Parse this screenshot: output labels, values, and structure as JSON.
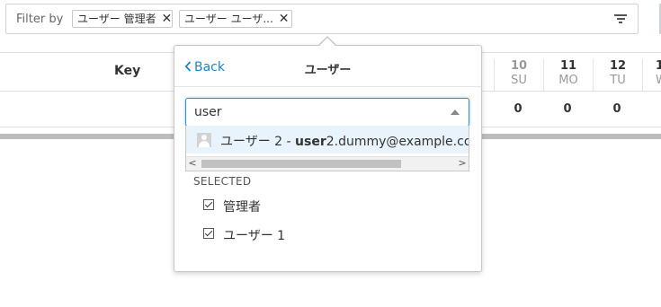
{
  "filter": {
    "label": "Filter by",
    "chips": [
      {
        "text": "ユーザー 管理者",
        "close": "✕"
      },
      {
        "text": "ユーザー ユーザ...",
        "close": "✕"
      }
    ]
  },
  "table": {
    "key_header": "Key",
    "days": [
      {
        "num": "10",
        "name": "SU",
        "muted": true
      },
      {
        "num": "11",
        "name": "MO"
      },
      {
        "num": "12",
        "name": "TU"
      },
      {
        "num": "1",
        "name": "W"
      }
    ],
    "counts": [
      "0",
      "0",
      "0"
    ]
  },
  "popover": {
    "back_label": "Back",
    "title": "ユーザー",
    "search_value": "user",
    "result": {
      "name": "ユーザー 2",
      "separator": " - ",
      "match": "user",
      "rest": "2.dummy@example.co"
    },
    "scroll_left": "<",
    "scroll_right": ">",
    "selected_label": "SELECTED",
    "selected_items": [
      "管理者",
      "ユーザー 1"
    ]
  },
  "icons": {
    "filter": "filter-lines-icon",
    "back": "chevron-left-icon",
    "dropdown": "caret-up-icon",
    "avatar": "user-avatar-icon",
    "check": "checkbox-checked-icon"
  },
  "colors": {
    "accent": "#1a86c8",
    "focus_border": "#2e8fd6",
    "highlight_row": "#e9f3fb"
  }
}
